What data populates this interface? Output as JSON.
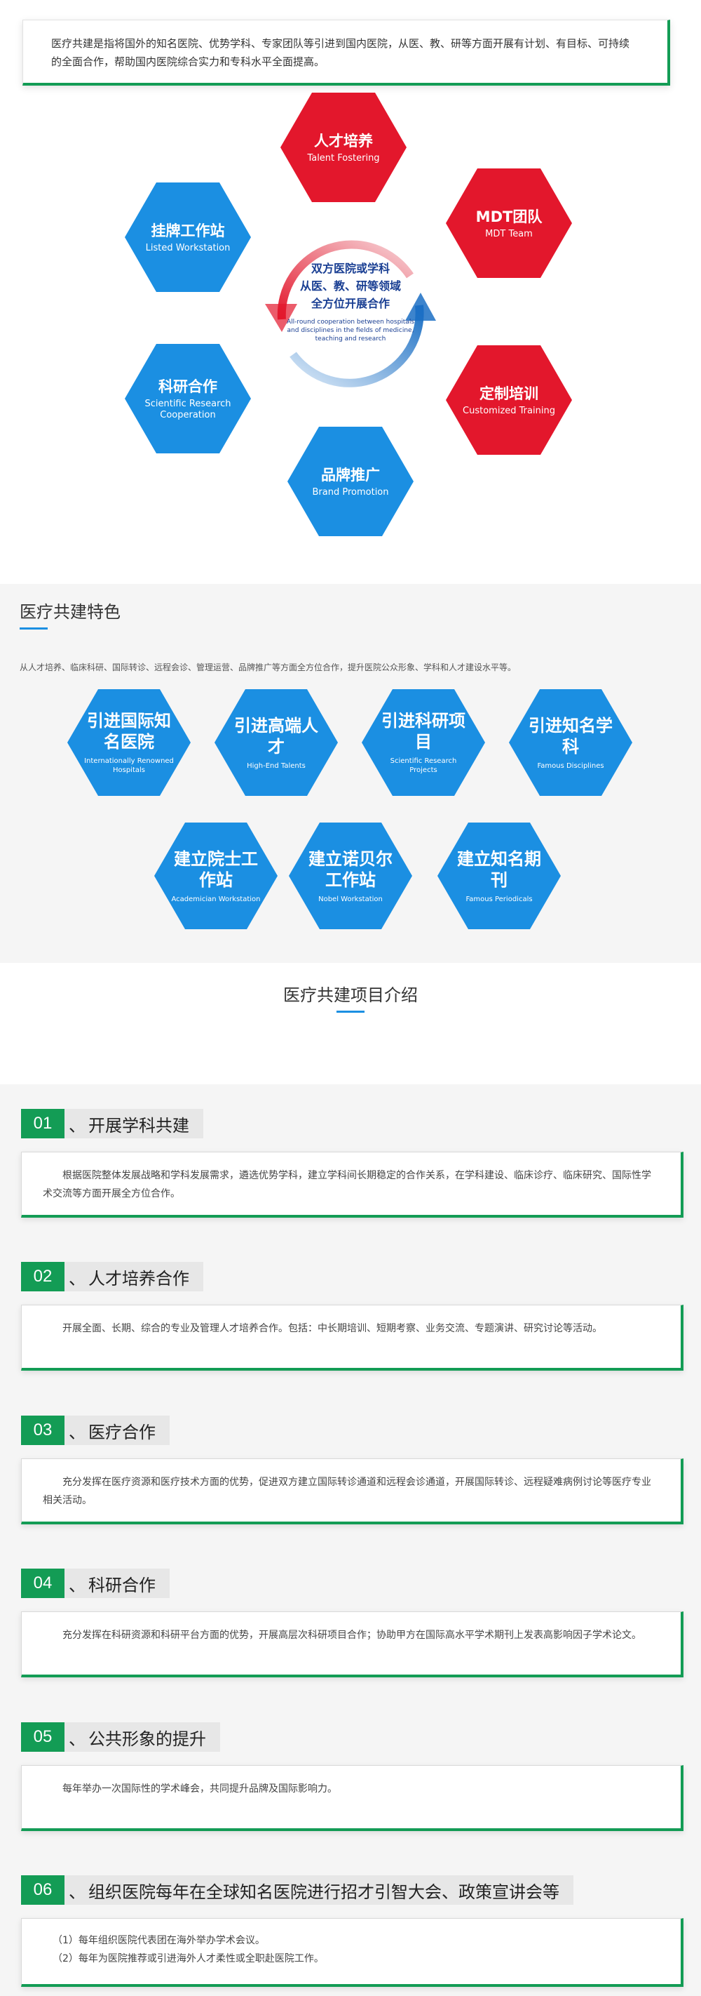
{
  "intro": "医疗共建是指将国外的知名医院、优势学科、专家团队等引进到国内医院，从医、教、研等方面开展有计划、有目标、可持续的全面合作，帮助国内医院综合实力和专科水平全面提高。",
  "diagram": {
    "center_lines": [
      "双方医院或学科",
      "从医、教、研等领域",
      "全方位开展合作"
    ],
    "center_en": "All-round cooperation between hospitals and disciplines in the fields of medicine, teaching and research",
    "hexes": [
      {
        "cn": "人才培养",
        "en": "Talent Fostering",
        "color": "red"
      },
      {
        "cn": "MDT团队",
        "en": "MDT Team",
        "color": "red"
      },
      {
        "cn": "定制培训",
        "en": "Customized Training",
        "color": "red"
      },
      {
        "cn": "品牌推广",
        "en": "Brand Promotion",
        "color": "blue"
      },
      {
        "cn": "科研合作",
        "en": "Scientific Research Cooperation",
        "color": "blue"
      },
      {
        "cn": "挂牌工作站",
        "en": "Listed Workstation",
        "color": "blue"
      }
    ],
    "colors": {
      "red": "#e3172c",
      "blue": "#1b8fe2"
    }
  },
  "features": {
    "title": "医疗共建特色",
    "desc": "从人才培养、临床科研、国际转诊、远程会诊、管理运营、品牌推广等方面全方位合作，提升医院公众形象、学科和人才建设水平等。",
    "items": [
      {
        "cn": "引进国际知名医院",
        "en": "Internationally Renowned Hospitals"
      },
      {
        "cn": "引进高端人才",
        "en": "High-End Talents"
      },
      {
        "cn": "引进科研项目",
        "en": "Scientific Research Projects"
      },
      {
        "cn": "引进知名学科",
        "en": "Famous Disciplines"
      },
      {
        "cn": "建立院士工作站",
        "en": "Academician Workstation"
      },
      {
        "cn": "建立诺贝尔工作站",
        "en": "Nobel Workstation"
      },
      {
        "cn": "建立知名期刊",
        "en": "Famous Periodicals"
      }
    ]
  },
  "projects": {
    "title": "医疗共建项目介绍",
    "items": [
      {
        "num": "01",
        "title": "开展学科共建",
        "lines": [
          "根据医院整体发展战略和学科发展需求，遴选优势学科，建立学科间长期稳定的合作关系，在学科建设、临床诊疗、临床研究、国际性学术交流等方面开展全方位合作。"
        ]
      },
      {
        "num": "02",
        "title": "人才培养合作",
        "lines": [
          "开展全面、长期、综合的专业及管理人才培养合作。包括：中长期培训、短期考察、业务交流、专题演讲、研究讨论等活动。"
        ]
      },
      {
        "num": "03",
        "title": "医疗合作",
        "lines": [
          "充分发挥在医疗资源和医疗技术方面的优势，促进双方建立国际转诊通道和远程会诊通道，开展国际转诊、远程疑难病例讨论等医疗专业相关活动。"
        ]
      },
      {
        "num": "04",
        "title": "科研合作",
        "lines": [
          "充分发挥在科研资源和科研平台方面的优势，开展高层次科研项目合作；协助甲方在国际高水平学术期刊上发表高影响因子学术论文。"
        ]
      },
      {
        "num": "05",
        "title": "公共形象的提升",
        "lines": [
          "每年举办一次国际性的学术峰会，共同提升品牌及国际影响力。"
        ]
      },
      {
        "num": "06",
        "title": "组织医院每年在全球知名医院进行招才引智大会、政策宣讲会等",
        "lines": [
          "（1）每年组织医院代表团在海外举办学术会议。",
          "（2）每年为医院推荐或引进海外人才柔性或全职赴医院工作。"
        ]
      }
    ]
  }
}
